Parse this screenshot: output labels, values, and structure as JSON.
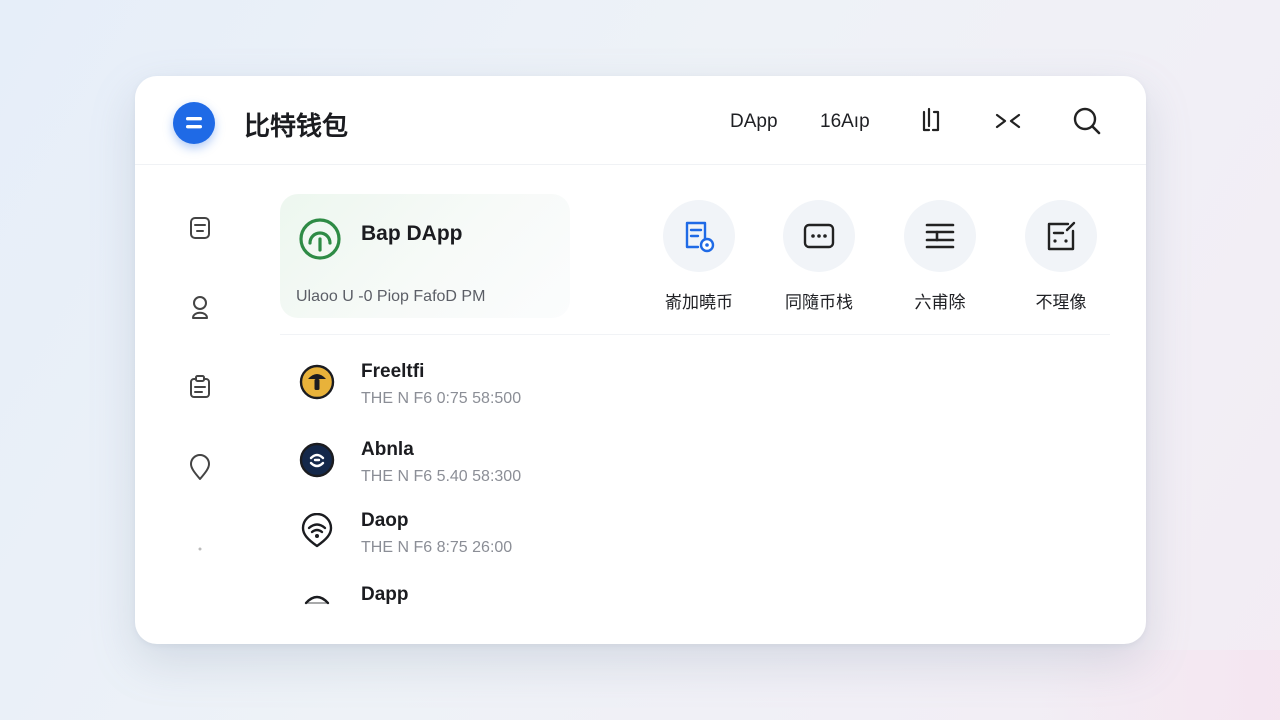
{
  "header": {
    "app_title": "比特钱包",
    "nav": [
      "DApp",
      "16Aıp"
    ]
  },
  "featured": {
    "title": "Bap DApp",
    "subtitle": "Ulaoo U -0 Piop FafoD PM"
  },
  "actions": [
    {
      "label": "嵛加曉币"
    },
    {
      "label": "同隨币栈"
    },
    {
      "label": "六甫除"
    },
    {
      "label": "不瑆像"
    }
  ],
  "dapps": [
    {
      "name": "Freeltfi",
      "meta": "THE N  F6 0:75 58:500"
    },
    {
      "name": "Abnla",
      "meta": "THE N  F6 5.40 58:300"
    },
    {
      "name": "Daop",
      "meta": "THE N  F6 8:75 26:00"
    },
    {
      "name": "Dapp",
      "meta": ""
    }
  ],
  "colors": {
    "accent": "#1f6ae6",
    "featured_green": "#2e8b45",
    "coin_gold": "#e8b23a",
    "coin_navy": "#14284a"
  }
}
